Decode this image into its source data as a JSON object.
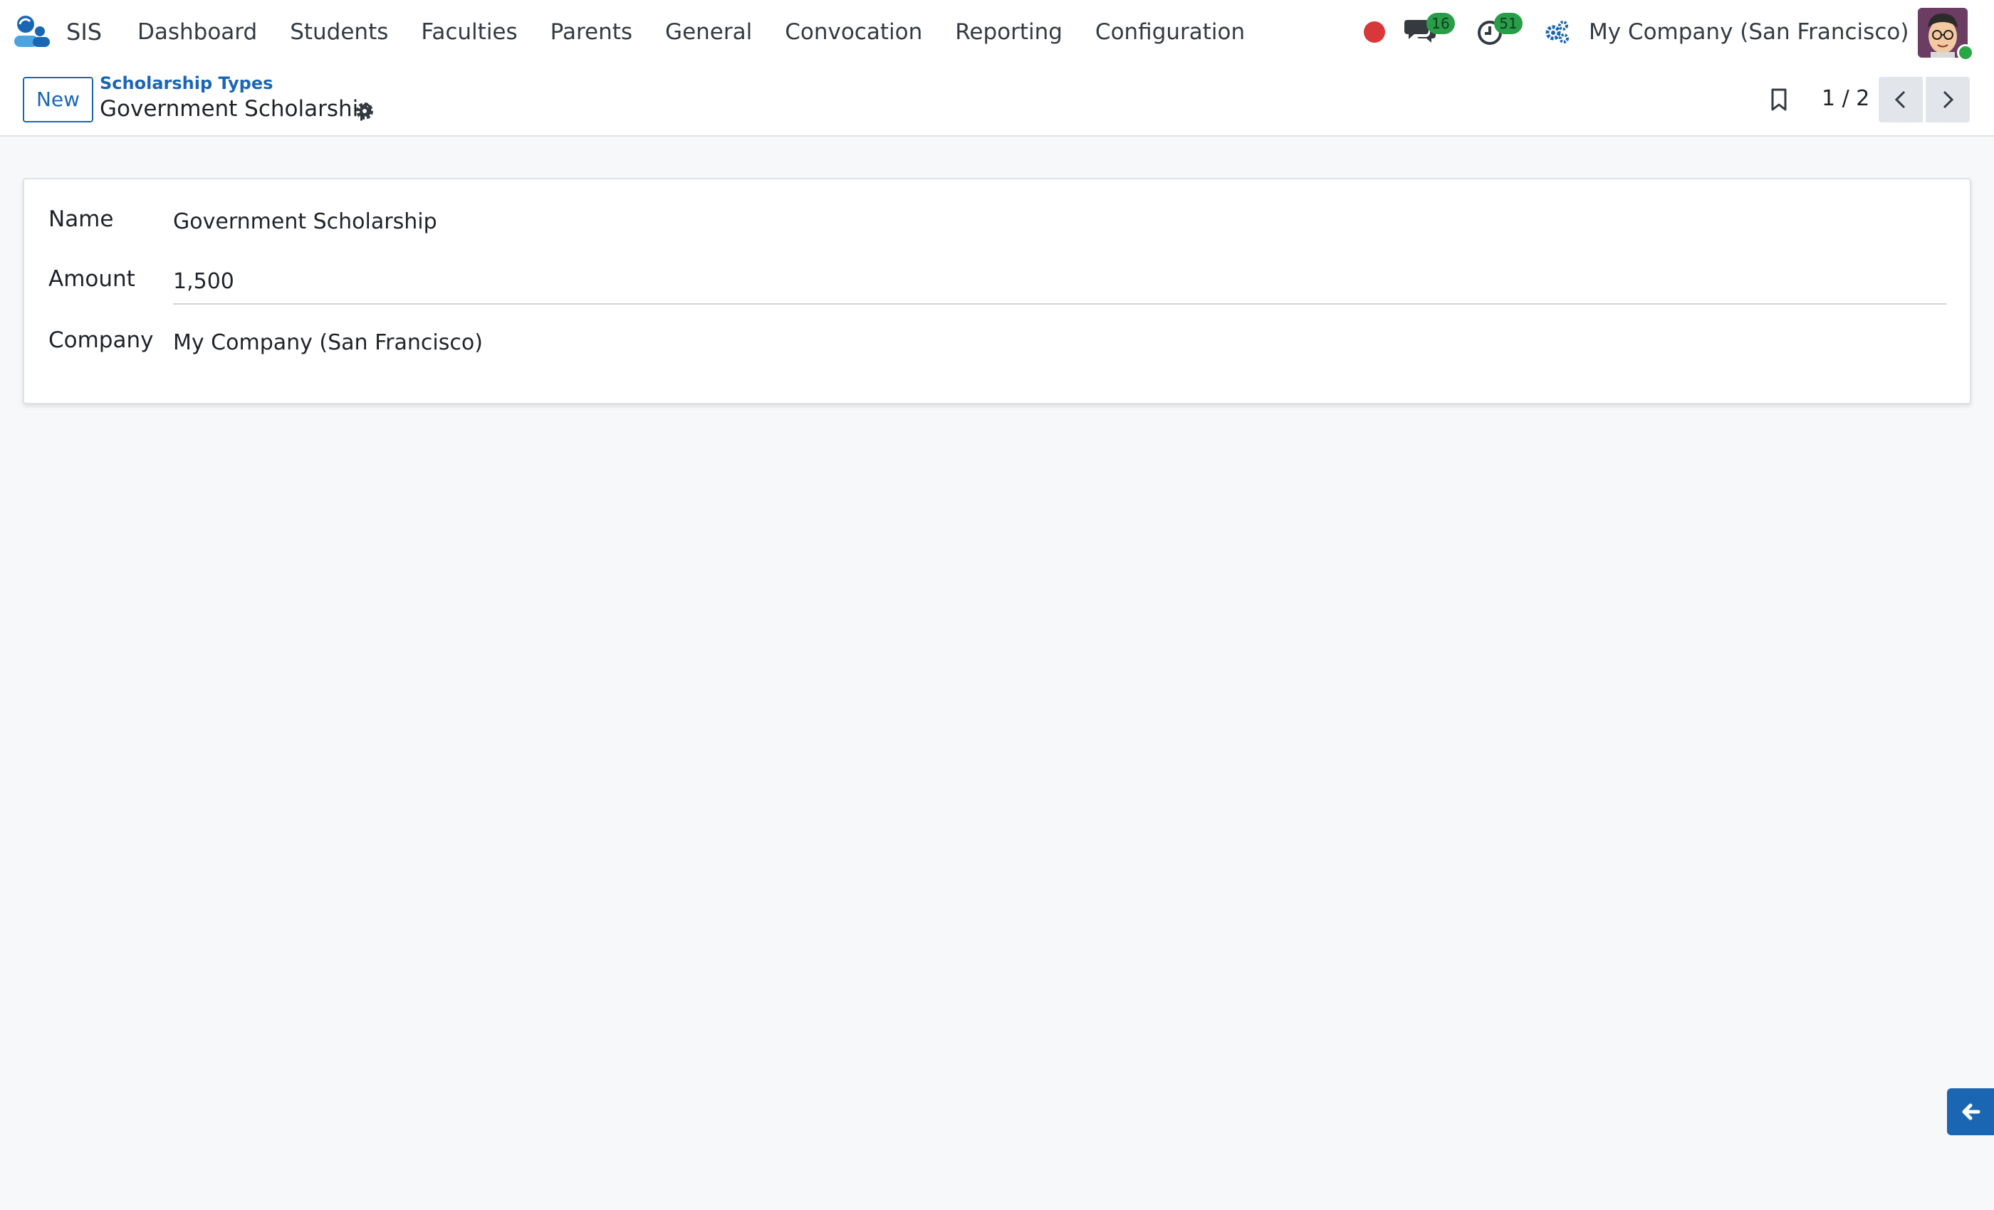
{
  "app": {
    "name": "SIS"
  },
  "menu": [
    {
      "label": "Dashboard"
    },
    {
      "label": "Students"
    },
    {
      "label": "Faculties"
    },
    {
      "label": "Parents"
    },
    {
      "label": "General"
    },
    {
      "label": "Convocation"
    },
    {
      "label": "Reporting"
    },
    {
      "label": "Configuration"
    }
  ],
  "systray": {
    "chat_count": "16",
    "activity_count": "51",
    "company": "My Company (San Francisco)",
    "icons": [
      "record-dot-icon",
      "chat-icon",
      "clock-icon",
      "gears-icon",
      "avatar"
    ]
  },
  "control": {
    "new_label": "New",
    "breadcrumb": "Scholarship Types",
    "record_title": "Government Scholarship",
    "pager": "1 / 2"
  },
  "form": {
    "fields": [
      {
        "label": "Name",
        "value": "Government Scholarship"
      },
      {
        "label": "Amount",
        "value": "1,500"
      },
      {
        "label": "Company",
        "value": "My Company (San Francisco)"
      }
    ]
  },
  "colors": {
    "brand": "#1a66b3",
    "badge": "#2a9d49",
    "record": "#d9383b",
    "background": "#f7f8fa"
  }
}
